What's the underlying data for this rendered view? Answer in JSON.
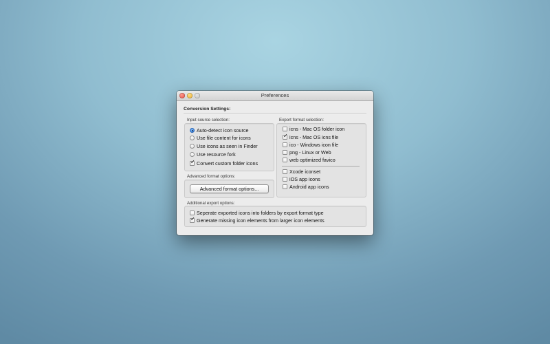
{
  "window": {
    "title": "Preferences"
  },
  "conversion_settings": {
    "heading": "Conversion Settings:",
    "input_source": {
      "label": "Input source selection:",
      "options": [
        {
          "label": "Auto-detect icon source",
          "selected": true
        },
        {
          "label": "Use file content for icons",
          "selected": false
        },
        {
          "label": "Use icons as seen in Finder",
          "selected": false
        },
        {
          "label": "Use resource fork",
          "selected": false
        }
      ],
      "convert_custom_folder": {
        "label": "Convert custom folder icons",
        "checked": true
      }
    },
    "advanced": {
      "label": "Advanced format options:",
      "button_label": "Advanced format options..."
    },
    "export_formats": {
      "label": "Export format selection:",
      "desktop": [
        {
          "label": "icns - Mac OS folder icon",
          "checked": false
        },
        {
          "label": "icns - Mac OS icns file",
          "checked": true
        },
        {
          "label": "ico  - Windows icon file",
          "checked": false
        },
        {
          "label": "png - Linux or Web",
          "checked": false
        },
        {
          "label": "web optimized favico",
          "checked": false
        }
      ],
      "dev": [
        {
          "label": "Xcode iconset",
          "checked": false
        },
        {
          "label": "iOS app icons",
          "checked": false
        },
        {
          "label": "Android app icons",
          "checked": false
        }
      ]
    },
    "additional": {
      "label": "Additional export options:",
      "options": [
        {
          "label": "Seperate exported icons into folders by export format type",
          "checked": false
        },
        {
          "label": "Generate missing icon elements from larger icon elements",
          "checked": true
        }
      ]
    }
  }
}
